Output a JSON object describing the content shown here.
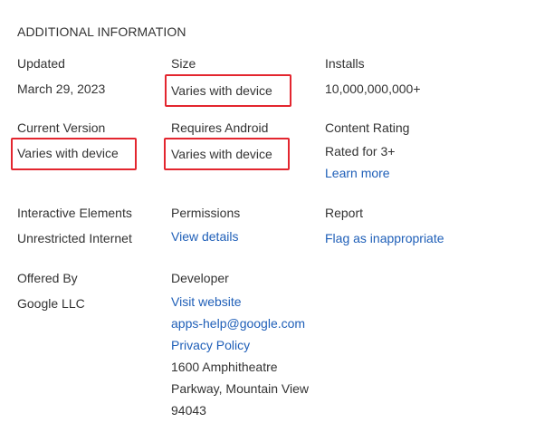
{
  "section": {
    "title": "ADDITIONAL INFORMATION"
  },
  "updated": {
    "label": "Updated",
    "value": "March 29, 2023"
  },
  "size": {
    "label": "Size",
    "value": "Varies with device"
  },
  "installs": {
    "label": "Installs",
    "value": "10,000,000,000+"
  },
  "current_version": {
    "label": "Current Version",
    "value": "Varies with device"
  },
  "requires_android": {
    "label": "Requires Android",
    "value": "Varies with device"
  },
  "content_rating": {
    "label": "Content Rating",
    "value": "Rated for 3+",
    "link": "Learn more"
  },
  "interactive_elements": {
    "label": "Interactive Elements",
    "value": "Unrestricted Internet"
  },
  "permissions": {
    "label": "Permissions",
    "link": "View details"
  },
  "report": {
    "label": "Report",
    "link": "Flag as inappropriate"
  },
  "offered_by": {
    "label": "Offered By",
    "value": "Google LLC"
  },
  "developer": {
    "label": "Developer",
    "website": "Visit website",
    "email": "apps-help@google.com",
    "privacy": "Privacy Policy",
    "address_line1": "1600 Amphitheatre",
    "address_line2": "Parkway, Mountain View",
    "address_line3": "94043"
  },
  "colors": {
    "link": "#1f5fb8",
    "highlight": "#e3262f",
    "text": "#333333"
  }
}
